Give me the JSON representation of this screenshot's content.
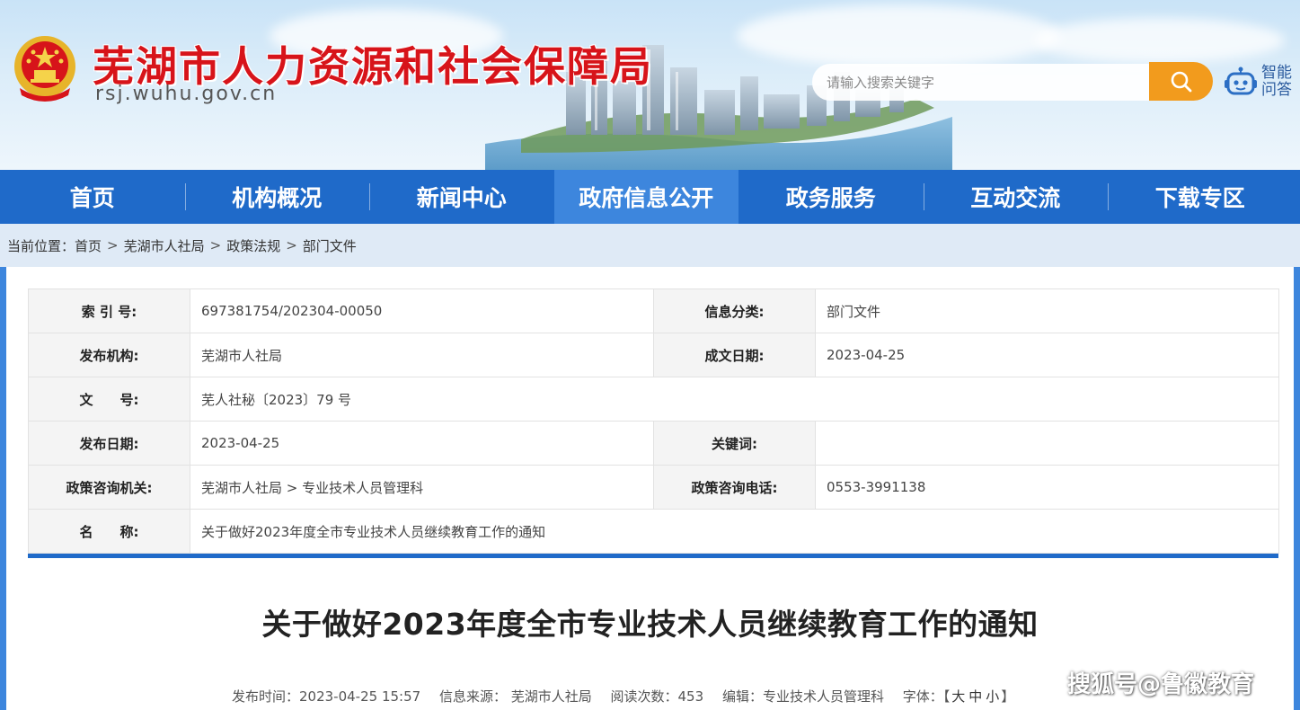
{
  "header": {
    "site_title": "芜湖市人力资源和社会保障局",
    "site_domain": "rsj.wuhu.gov.cn",
    "search": {
      "placeholder": "请输入搜索关键字"
    },
    "smart_qa_line1": "智能",
    "smart_qa_line2": "问答"
  },
  "nav": [
    {
      "label": "首页",
      "active": false
    },
    {
      "label": "机构概况",
      "active": false
    },
    {
      "label": "新闻中心",
      "active": false
    },
    {
      "label": "政府信息公开",
      "active": true
    },
    {
      "label": "政务服务",
      "active": false
    },
    {
      "label": "互动交流",
      "active": false
    },
    {
      "label": "下载专区",
      "active": false
    }
  ],
  "breadcrumb": {
    "prefix": "当前位置：",
    "items": [
      "首页",
      "芜湖市人社局",
      "政策法规",
      "部门文件"
    ],
    "separator": ">"
  },
  "info": {
    "index_label": "索 引 号:",
    "index_value": "697381754/202304-00050",
    "category_label": "信息分类:",
    "category_value": "部门文件",
    "publisher_label": "发布机构:",
    "publisher_value": "芜湖市人社局",
    "date_made_label": "成文日期:",
    "date_made_value": "2023-04-25",
    "doc_no_label": "文　　号:",
    "doc_no_value": "芜人社秘〔2023〕79 号",
    "pub_date_label": "发布日期:",
    "pub_date_value": "2023-04-25",
    "keywords_label": "关键词:",
    "keywords_value": "",
    "consult_org_label": "政策咨询机关:",
    "consult_org_value": "芜湖市人社局 > 专业技术人员管理科",
    "consult_phone_label": "政策咨询电话:",
    "consult_phone_value": "0553-3991138",
    "name_label": "名　　称:",
    "name_value": "关于做好2023年度全市专业技术人员继续教育工作的通知"
  },
  "article": {
    "title": "关于做好2023年度全市专业技术人员继续教育工作的通知",
    "meta": {
      "publish_time": "发布时间：2023-04-25 15:57",
      "source": "信息来源：  芜湖市人社局",
      "views": "阅读次数：453",
      "editor": "编辑：专业技术人员管理科",
      "font_label": "字体：",
      "font_open": "【",
      "font_large": "大",
      "font_medium": "中",
      "font_small": "小",
      "font_close": "】"
    }
  },
  "watermark": "搜狐号@鲁徽教育",
  "colors": {
    "nav_bg": "#1f6ac9",
    "nav_active": "#3d86dd",
    "title_red": "#d7141a",
    "search_orange": "#f29b1d"
  }
}
